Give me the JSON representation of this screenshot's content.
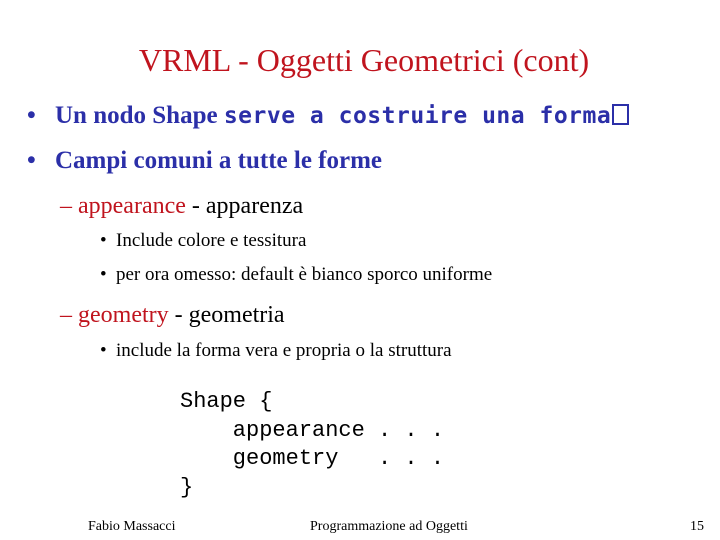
{
  "slide": {
    "title": "VRML - Oggetti Geometrici (cont)",
    "bullets": [
      {
        "bullet": "•",
        "text_serif": "Un nodo Shape ",
        "text_mono": "serve a costruire una forma"
      },
      {
        "bullet": "•",
        "text_serif": "Campi comuni a tutte le forme"
      }
    ],
    "subitems": [
      {
        "dash": "–",
        "keyword": "appearance",
        "desc": " - apparenza",
        "points": [
          "Include colore e tessitura",
          "per ora omesso: default è bianco sporco uniforme"
        ]
      },
      {
        "dash": "–",
        "keyword": "geometry",
        "desc": " - geometria",
        "points": [
          "include la forma vera e propria o la struttura"
        ]
      }
    ],
    "code": "Shape {\n    appearance . . .\n    geometry   . . .\n}",
    "colors": {
      "title": "#c0141e",
      "bullet_text": "#2b2fa8",
      "keyword": "#c0141e",
      "body": "#000000"
    }
  },
  "footer": {
    "author": "Fabio Massacci",
    "course": "Programmazione ad Oggetti",
    "page_number": "15"
  }
}
